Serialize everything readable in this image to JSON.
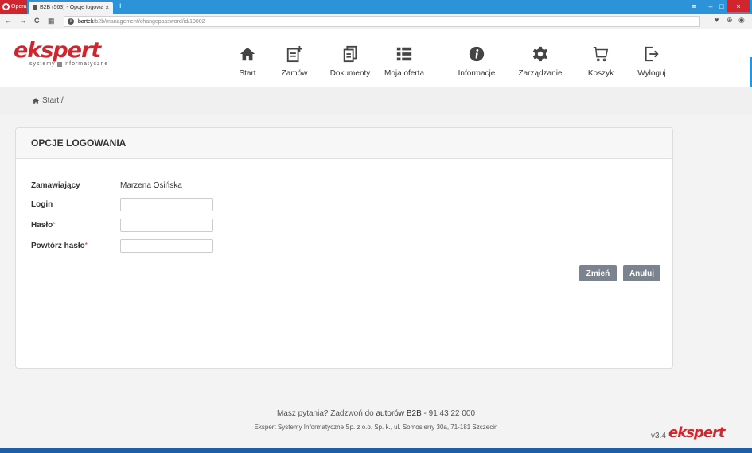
{
  "browser": {
    "opera_label": "Opera",
    "tab_title": "B2B (563) - Opcje logowani",
    "tab_close": "×",
    "new_tab": "+",
    "url_host": "bartek",
    "url_path": "/b2b/management/changepassword/id/10002",
    "back": "←",
    "forward": "→",
    "reload": "C",
    "grid": "▦",
    "win_menu": "≡",
    "win_min": "–",
    "win_max": "□",
    "win_close": "×",
    "heart": "♥",
    "download": "⊕",
    "account": "◉"
  },
  "header": {
    "logo_text": "ekspert",
    "logo_sub_1": "systemy",
    "logo_sub_2": "informatyczne",
    "nav": [
      {
        "label": "Start",
        "icon": "home-icon"
      },
      {
        "label": "Zamów",
        "icon": "order-add-icon"
      },
      {
        "label": "Dokumenty",
        "icon": "documents-icon"
      },
      {
        "label": "Moja oferta",
        "icon": "list-icon"
      },
      {
        "label": "Informacje",
        "icon": "info-icon"
      },
      {
        "label": "Zarządzanie",
        "icon": "gear-icon"
      },
      {
        "label": "Koszyk",
        "icon": "cart-icon"
      },
      {
        "label": "Wyloguj",
        "icon": "logout-icon"
      }
    ]
  },
  "breadcrumb": {
    "icon": "home-icon",
    "label": "Start /"
  },
  "panel": {
    "title": "OPCJE LOGOWANIA",
    "ordering_label": "Zamawiający",
    "ordering_value": "Marzena Osińska",
    "login_label": "Login",
    "login_value": "",
    "password_label": "Hasło",
    "repeat_label": "Powtórz hasło",
    "required_mark": "*",
    "change_button": "Zmień",
    "cancel_button": "Anuluj"
  },
  "footer": {
    "question_prefix": "Masz pytania? Zadzwoń do ",
    "question_bold": "autorów B2B",
    "question_phone": " - 91 43 22 000",
    "address": "Ekspert Systemy Informatyczne Sp. z o.o. Sp. k., ul. Somosierry 30a, 71-181 Szczecin",
    "version": "v3.4",
    "logo_text": "ekspert"
  },
  "colors": {
    "brand_red": "#d1252e",
    "tabbar_blue": "#2d93d8",
    "button_gray": "#7b848e"
  }
}
